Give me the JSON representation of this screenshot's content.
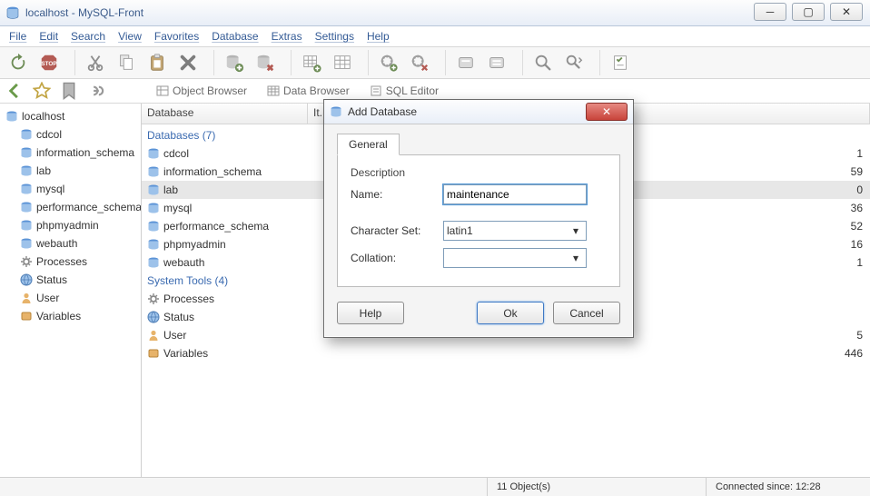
{
  "window": {
    "title": "localhost - MySQL-Front"
  },
  "menus": {
    "file": "File",
    "edit": "Edit",
    "search": "Search",
    "view": "View",
    "favorites": "Favorites",
    "database": "Database",
    "extras": "Extras",
    "settings": "Settings",
    "help": "Help"
  },
  "toolbars": {
    "browserTabs": {
      "object": "Object Browser",
      "data": "Data Browser",
      "sql": "SQL Editor"
    }
  },
  "tree": {
    "root": "localhost",
    "items": [
      "cdcol",
      "information_schema",
      "lab",
      "mysql",
      "performance_schema",
      "phpmyadmin",
      "webauth",
      "Processes",
      "Status",
      "User",
      "Variables"
    ]
  },
  "grid": {
    "headers": {
      "c1": "Database",
      "c2": "It..."
    },
    "section_db": "Databases (7)",
    "db_rows": [
      {
        "name": "cdcol",
        "it": "1"
      },
      {
        "name": "information_schema",
        "it": "59"
      },
      {
        "name": "lab",
        "it": "0",
        "selected": true
      },
      {
        "name": "mysql",
        "it": "36"
      },
      {
        "name": "performance_schema",
        "it": "52"
      },
      {
        "name": "phpmyadmin",
        "it": "16"
      },
      {
        "name": "webauth",
        "it": "1"
      }
    ],
    "section_sys": "System Tools (4)",
    "sys_rows": [
      {
        "name": "Processes",
        "it": ""
      },
      {
        "name": "Status",
        "it": ""
      },
      {
        "name": "User",
        "it": "5"
      },
      {
        "name": "Variables",
        "it": "446"
      }
    ]
  },
  "dialog": {
    "title": "Add Database",
    "tab": "General",
    "section": "Description",
    "name_label": "Name:",
    "name_value": "maintenance",
    "charset_label": "Character Set:",
    "charset_value": "latin1",
    "collation_label": "Collation:",
    "collation_value": "",
    "help": "Help",
    "ok": "Ok",
    "cancel": "Cancel"
  },
  "status": {
    "objects": "11 Object(s)",
    "connected": "Connected since: 12:28"
  }
}
